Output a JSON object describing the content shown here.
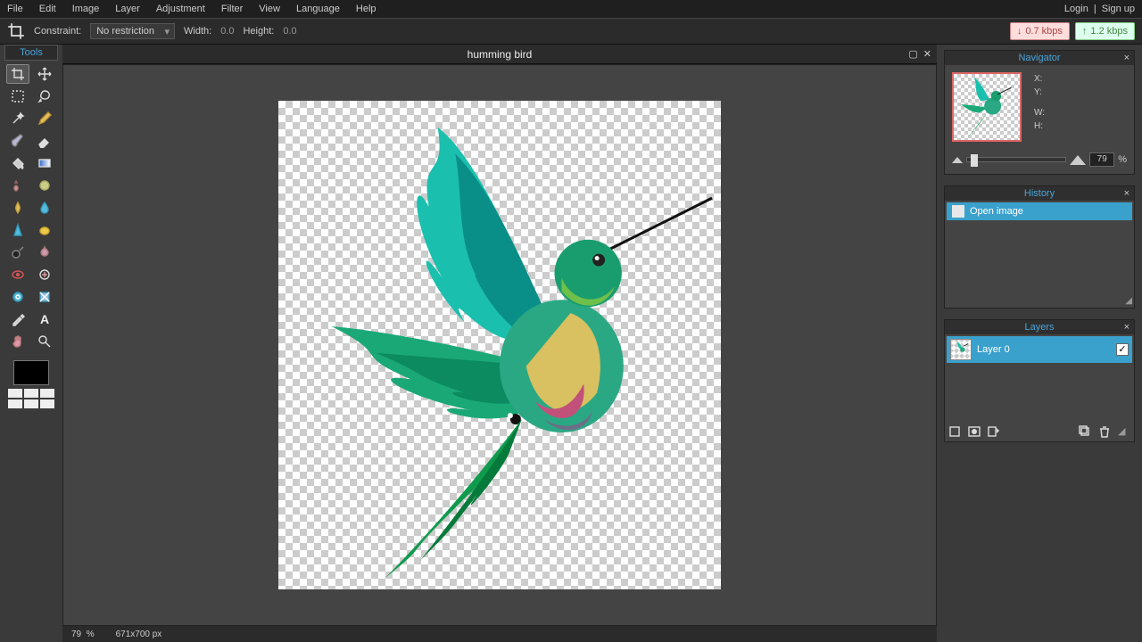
{
  "menubar": {
    "items": [
      "File",
      "Edit",
      "Image",
      "Layer",
      "Adjustment",
      "Filter",
      "View",
      "Language",
      "Help"
    ],
    "login": "Login",
    "signup": "Sign up"
  },
  "options": {
    "constraint_label": "Constraint:",
    "constraint_value": "No restriction",
    "width_label": "Width:",
    "width_value": "0.0",
    "height_label": "Height:",
    "height_value": "0.0"
  },
  "net": {
    "down": "0.7 kbps",
    "up": "1.2 kbps"
  },
  "tools_title": "Tools",
  "tools": [
    "crop",
    "move",
    "marquee",
    "lasso",
    "wand",
    "pencil",
    "brush",
    "eraser",
    "paintbucket",
    "gradient",
    "clone",
    "colorreplace",
    "smudge",
    "blur",
    "sharpen",
    "sponge",
    "dodge",
    "burn",
    "redeye",
    "spotheal",
    "bloat",
    "pinch",
    "colorpicker",
    "type",
    "hand",
    "zoom"
  ],
  "document": {
    "title": "humming bird"
  },
  "status": {
    "zoom": "79",
    "pct": "%",
    "dims": "671x700 px"
  },
  "panels": {
    "navigator": {
      "title": "Navigator",
      "x_label": "X:",
      "y_label": "Y:",
      "w_label": "W:",
      "h_label": "H:",
      "zoom": "79",
      "pct": "%"
    },
    "history": {
      "title": "History",
      "items": [
        "Open image"
      ]
    },
    "layers": {
      "title": "Layers",
      "rows": [
        {
          "name": "Layer 0"
        }
      ]
    }
  }
}
